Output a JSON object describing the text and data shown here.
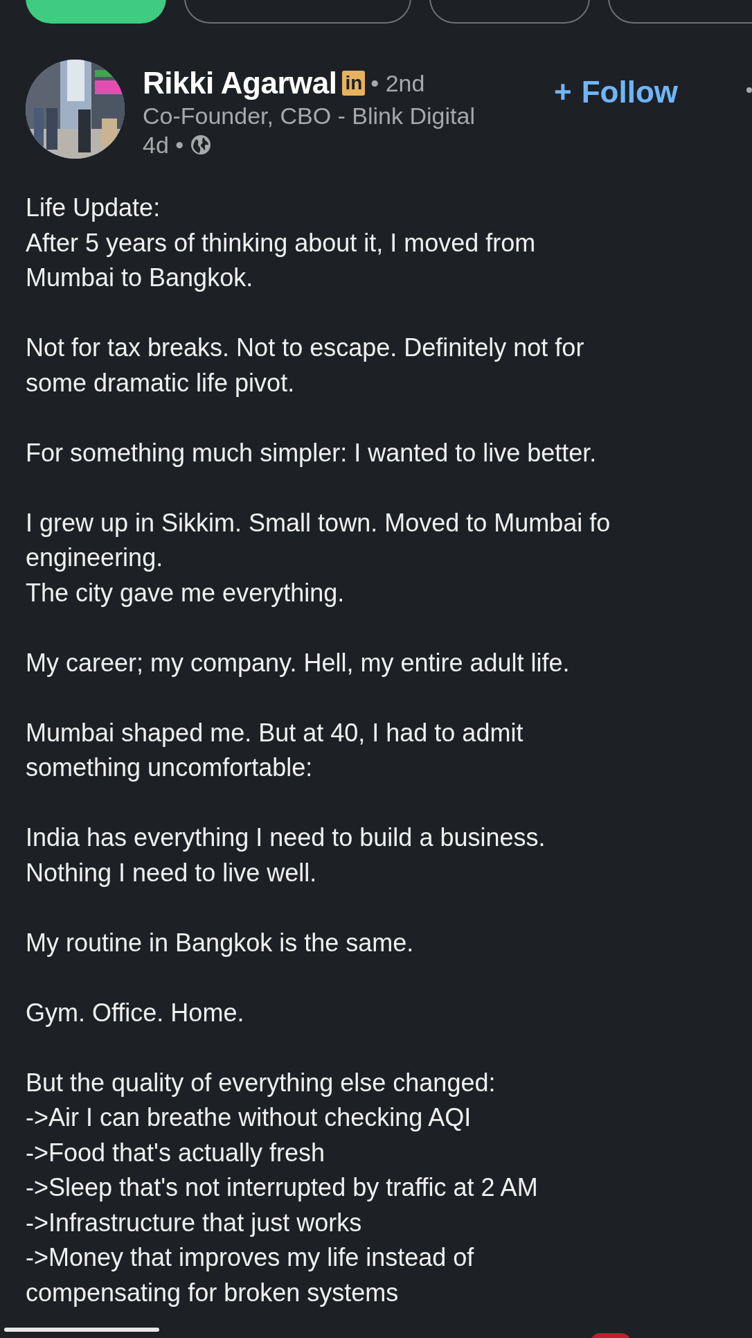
{
  "tabs": [
    {
      "selected": true
    },
    {
      "selected": false
    },
    {
      "selected": false
    },
    {
      "selected": false
    }
  ],
  "post": {
    "author": {
      "name": "Rikki Agarwal",
      "badge": "in",
      "degree": "• 2nd",
      "headline": "Co-Founder, CBO - Blink Digital",
      "age": "4d •"
    },
    "follow": {
      "icon": "+",
      "label": "Follow"
    },
    "paragraphs": [
      [
        "Life Update:",
        "After 5 years of thinking about it, I moved from",
        "Mumbai to Bangkok."
      ],
      [
        "Not for tax breaks. Not to escape. Definitely not for",
        "some dramatic life pivot."
      ],
      [
        "For something much simpler: I wanted to live better."
      ],
      [
        "I grew up in Sikkim. Small town. Moved to Mumbai fo",
        "engineering.",
        "The city gave me everything."
      ],
      [
        "My career; my company. Hell, my entire adult life."
      ],
      [
        "Mumbai shaped me. But at 40, I had to admit",
        "something uncomfortable:"
      ],
      [
        "India has everything I need to build a business.",
        "Nothing I need to live well."
      ],
      [
        "My routine in Bangkok is the same."
      ],
      [
        "Gym. Office. Home."
      ],
      [
        "But the quality of everything else changed:",
        "->Air I can breathe without checking AQI",
        "->Food that's actually fresh",
        "->Sleep that's not interrupted by traffic at 2 AM",
        "->Infrastructure that just works",
        "->Money that improves my life instead of",
        "compensating for broken systems"
      ]
    ]
  }
}
